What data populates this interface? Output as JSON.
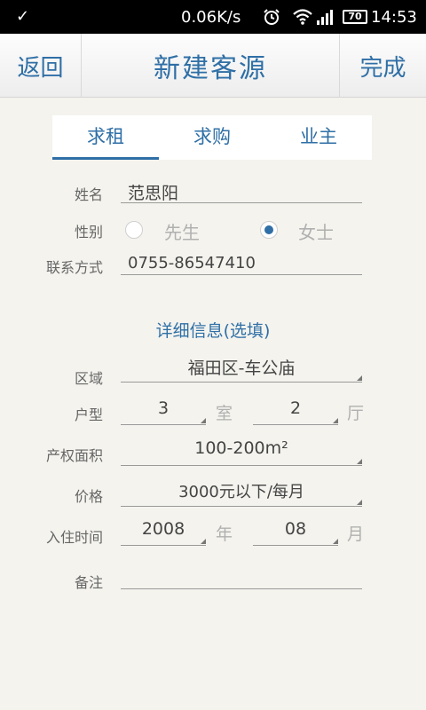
{
  "status_bar": {
    "speed": "0.06K/s",
    "battery": "70",
    "time": "14:53"
  },
  "header": {
    "back": "返回",
    "title": "新建客源",
    "done": "完成"
  },
  "tabs": [
    {
      "label": "求租",
      "active": true
    },
    {
      "label": "求购",
      "active": false
    },
    {
      "label": "业主",
      "active": false
    }
  ],
  "form": {
    "name_label": "姓名",
    "name_value": "范思阳",
    "gender_label": "性别",
    "gender_male": "先生",
    "gender_female": "女士",
    "gender_selected": "女士",
    "contact_label": "联系方式",
    "contact_value": "0755-86547410"
  },
  "details": {
    "title": "详细信息(选填)",
    "area_label": "区域",
    "area_value": "福田区-车公庙",
    "layout_label": "户型",
    "rooms_value": "3",
    "rooms_unit": "室",
    "halls_value": "2",
    "halls_unit": "厅",
    "size_label": "产权面积",
    "size_value": "100-200m²",
    "price_label": "价格",
    "price_value": "3000元以下/每月",
    "movein_label": "入住时间",
    "year_value": "2008",
    "year_unit": "年",
    "month_value": "08",
    "month_unit": "月",
    "remark_label": "备注",
    "remark_value": ""
  }
}
